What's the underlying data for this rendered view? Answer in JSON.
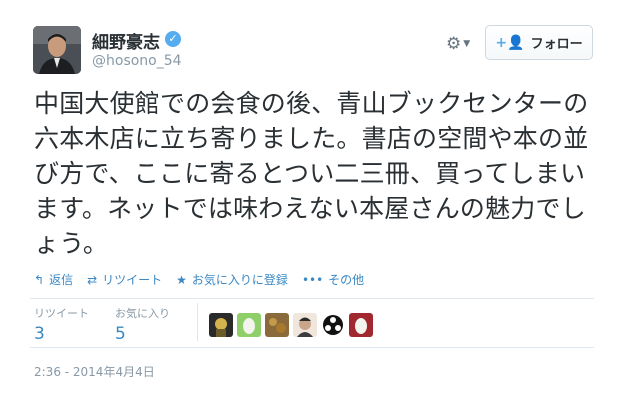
{
  "user": {
    "display_name": "細野豪志",
    "handle": "@hosono_54",
    "verified_glyph": "✓"
  },
  "header": {
    "follow_label": "フォロー",
    "follow_icon": "+👤"
  },
  "tweet": {
    "text": "中国大使館での会食の後、青山ブックセンターの六本木店に立ち寄りました。書店の空間や本の並び方で、ここに寄るとつい二三冊、買ってしまいます。ネットでは味わえない本屋さんの魅力でしょう。"
  },
  "actions": {
    "reply": "返信",
    "retweet": "リツイート",
    "favorite": "お気に入りに登録",
    "more": "その他"
  },
  "stats": {
    "retweets_label": "リツイート",
    "retweets_count": "3",
    "favorites_label": "お気に入り",
    "favorites_count": "5"
  },
  "favoriters": [
    "avatar-1",
    "avatar-2",
    "avatar-3",
    "avatar-4",
    "avatar-5",
    "avatar-6"
  ],
  "timestamp": "2:36 - 2014年4月4日",
  "colors": {
    "link": "#3b88c3",
    "muted": "#8899a6",
    "text": "#292f33",
    "verified": "#55acee"
  }
}
